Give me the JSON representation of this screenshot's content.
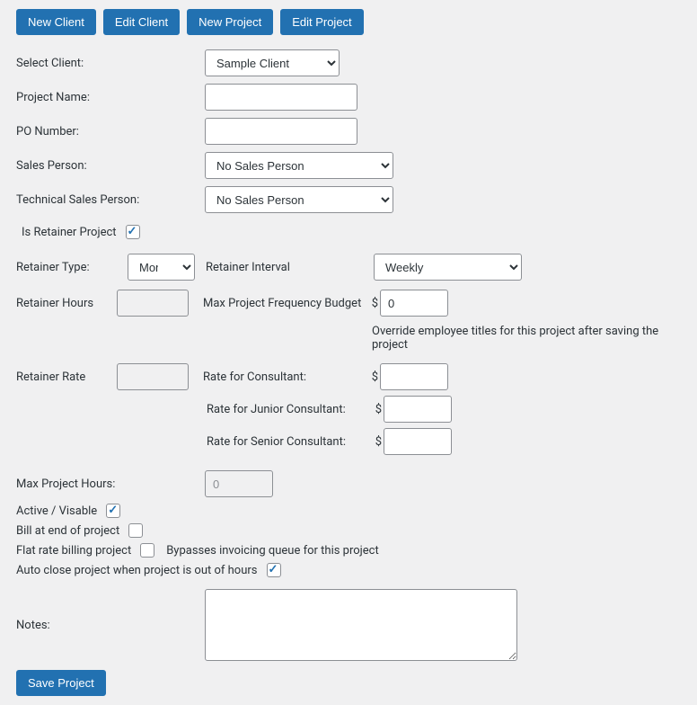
{
  "buttons": {
    "new_client": "New Client",
    "edit_client": "Edit Client",
    "new_project": "New Project",
    "edit_project": "Edit Project",
    "save_project": "Save Project"
  },
  "labels": {
    "select_client": "Select Client:",
    "project_name": "Project Name:",
    "po_number": "PO Number:",
    "sales_person": "Sales Person:",
    "tech_sales_person": "Technical Sales Person:",
    "is_retainer": "Is Retainer Project",
    "retainer_type": "Retainer Type:",
    "retainer_interval": "Retainer Interval",
    "retainer_hours": "Retainer Hours",
    "max_freq_budget": "Max Project Frequency Budget",
    "retainer_rate": "Retainer Rate",
    "rate_consultant": "Rate for Consultant:",
    "rate_junior": "Rate for Junior Consultant:",
    "rate_senior": "Rate for Senior Consultant:",
    "max_hours": "Max Project Hours:",
    "active_visible": "Active / Visable",
    "bill_end": "Bill at end of project",
    "flat_rate": "Flat rate billing project",
    "flat_rate_hint": "Bypasses invoicing queue for this project",
    "auto_close": "Auto close project when project is out of hours",
    "notes": "Notes:",
    "override_hint": "Override employee titles for this project after saving the project",
    "dollar": "$"
  },
  "values": {
    "select_client": "Sample Client",
    "project_name": "",
    "po_number": "",
    "sales_person": "No Sales Person",
    "tech_sales_person": "No Sales Person",
    "is_retainer": true,
    "retainer_type": "Money",
    "retainer_interval": "Weekly",
    "retainer_hours": "",
    "max_freq_budget": "0",
    "retainer_rate": "",
    "rate_consultant": "",
    "rate_junior": "",
    "rate_senior": "",
    "max_hours_placeholder": "0",
    "active_visible": true,
    "bill_end": false,
    "flat_rate": false,
    "auto_close": true,
    "notes": ""
  }
}
